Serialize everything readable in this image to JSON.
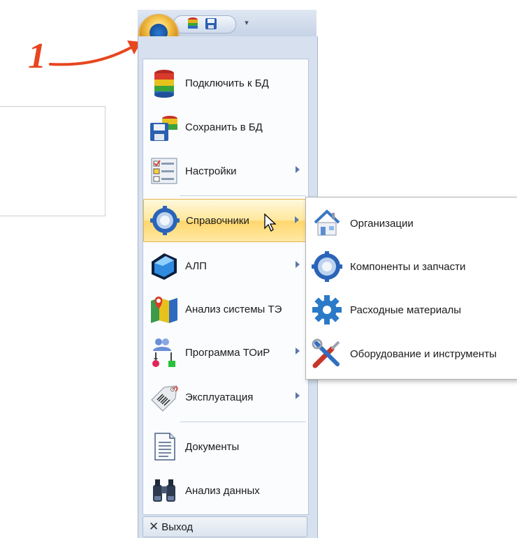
{
  "annotation": {
    "number": "1"
  },
  "menu": {
    "items": [
      {
        "label": "Подключить к БД",
        "icon": "database-icon",
        "submenu": false
      },
      {
        "label": "Сохранить в БД",
        "icon": "save-to-db-icon",
        "submenu": false
      },
      {
        "label": "Настройки",
        "icon": "settings-checklist-icon",
        "submenu": true
      },
      {
        "label": "Справочники",
        "icon": "gear-icon",
        "submenu": true,
        "active": true
      },
      {
        "label": "АЛП",
        "icon": "blue-cube-icon",
        "submenu": true
      },
      {
        "label": "Анализ системы ТЭ",
        "icon": "map-pin-icon",
        "submenu": false
      },
      {
        "label": "Программа ТОиР",
        "icon": "workflow-people-icon",
        "submenu": true
      },
      {
        "label": "Эксплуатация",
        "icon": "barcode-tag-icon",
        "submenu": true
      },
      {
        "label": "Документы",
        "icon": "document-icon",
        "submenu": false
      },
      {
        "label": "Анализ данных",
        "icon": "binoculars-icon",
        "submenu": false
      }
    ],
    "exit_label": "Выход"
  },
  "submenu": {
    "items": [
      {
        "label": "Организации",
        "icon": "house-icon"
      },
      {
        "label": "Компоненты и запчасти",
        "icon": "gear-icon"
      },
      {
        "label": "Расходные материалы",
        "icon": "cog-icon"
      },
      {
        "label": "Оборудование и инструменты",
        "icon": "tools-icon"
      }
    ]
  },
  "colors": {
    "accent_highlight": "#ffe79a",
    "annotation": "#e8461f",
    "frame": "#d6e0ee"
  }
}
